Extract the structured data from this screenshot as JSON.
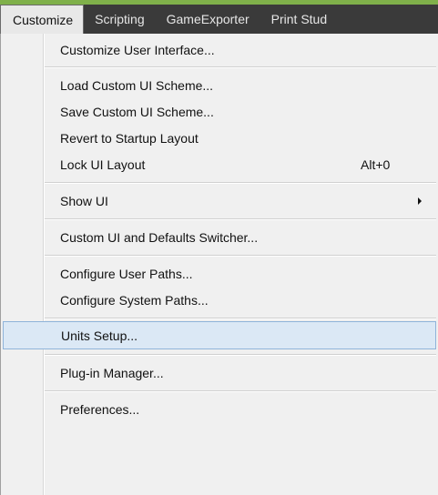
{
  "menubar": {
    "items": [
      {
        "label": "Customize",
        "active": true
      },
      {
        "label": "Scripting",
        "active": false
      },
      {
        "label": "GameExporter",
        "active": false
      },
      {
        "label": "Print Stud",
        "active": false
      }
    ]
  },
  "dropdown": {
    "items": [
      {
        "label": "Customize User Interface..."
      },
      {
        "label": "Load Custom UI Scheme..."
      },
      {
        "label": "Save Custom UI Scheme..."
      },
      {
        "label": "Revert to Startup Layout"
      },
      {
        "label": "Lock UI Layout",
        "shortcut": "Alt+0"
      },
      {
        "label": "Show UI",
        "submenu_icon": "submenu-arrow-icon"
      },
      {
        "label": "Custom UI and Defaults Switcher..."
      },
      {
        "label": "Configure User Paths..."
      },
      {
        "label": "Configure System Paths..."
      },
      {
        "label": "Units Setup...",
        "highlighted": true
      },
      {
        "label": "Plug-in Manager..."
      },
      {
        "label": "Preferences..."
      }
    ]
  },
  "colors": {
    "menubar_bg": "#3a3a3a",
    "menubar_accent": "#7fb04a",
    "dropdown_bg": "#f0f0f0",
    "highlight_bg": "#dbe8f5",
    "highlight_border": "#8fb3d9"
  }
}
